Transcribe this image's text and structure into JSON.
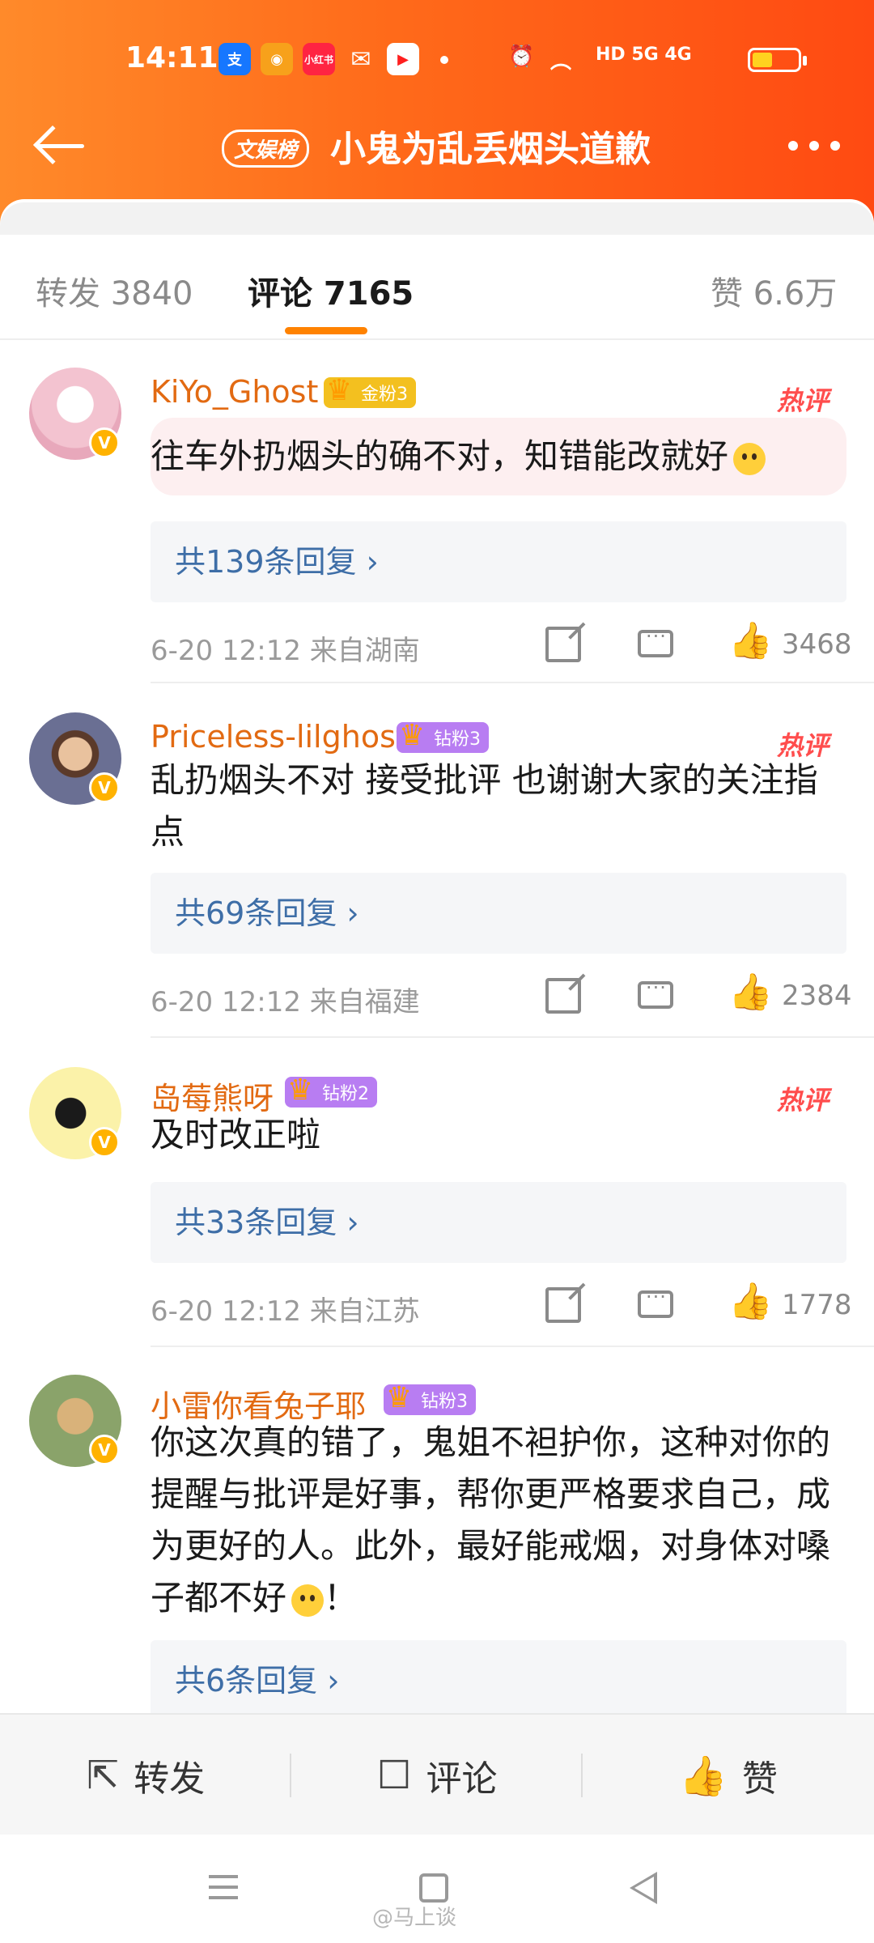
{
  "status_bar": {
    "time": "14:11",
    "apps": [
      {
        "icon": "alipay-icon",
        "text": "支",
        "color": "#1677ff"
      },
      {
        "icon": "weibo-icon",
        "text": "◉",
        "color": "#f7a11b"
      },
      {
        "icon": "xiaohongshu-icon",
        "text": "小红书",
        "color": "#ff2442"
      },
      {
        "icon": "wechat-icon",
        "text": "✉",
        "color": "#ffffff"
      },
      {
        "icon": "video-icon",
        "text": "▶",
        "color": "#ff1f1f"
      }
    ],
    "network": "HD 5G 4G"
  },
  "nav": {
    "badge": "文娱榜",
    "title": "小鬼为乱丢烟头道歉"
  },
  "tabs": {
    "repost": "转发 3840",
    "comments": "评论 7165",
    "likes": "赞 6.6万"
  },
  "comments": [
    {
      "username": "KiYo_Ghost",
      "fan_level": "金粉3",
      "fan_type": "gold",
      "hot_label": "热评",
      "text": "往车外扔烟头的确不对，知错能改就好",
      "replies": "共139条回复 ›",
      "meta": "6-20 12:12  来自湖南",
      "likes": "3468",
      "avatar_color": "#f6d3dc"
    },
    {
      "username": "Priceless-lilghost",
      "fan_level": "钻粉3",
      "fan_type": "diamond",
      "hot_label": "热评",
      "text": "乱扔烟头不对 接受批评 也谢谢大家的关注指点",
      "replies": "共69条回复 ›",
      "meta": "6-20 12:12  来自福建",
      "likes": "2384",
      "avatar_color": "#6a6f93"
    },
    {
      "username": "岛莓熊呀",
      "fan_level": "钻粉2",
      "fan_type": "diamond",
      "hot_label": "热评",
      "text": "及时改正啦",
      "replies": "共33条回复 ›",
      "meta": "6-20 12:12  来自江苏",
      "likes": "1778",
      "avatar_color": "#fbf2a9"
    },
    {
      "username": "小雷你看兔子耶",
      "fan_level": "钻粉3",
      "fan_type": "diamond",
      "text": "你这次真的错了，鬼姐不袒护你，这种对你的提醒与批评是好事，帮你更严格要求自己，成为更好的人。此外，最好能戒烟，对身体对嗓子都不好",
      "text_end": "！",
      "replies": "共6条回复 ›",
      "avatar_color": "#8aa36a"
    }
  ],
  "bottom_bar": {
    "repost": "转发",
    "comment": "评论",
    "like": "赞"
  },
  "watermark": "@马上谈"
}
